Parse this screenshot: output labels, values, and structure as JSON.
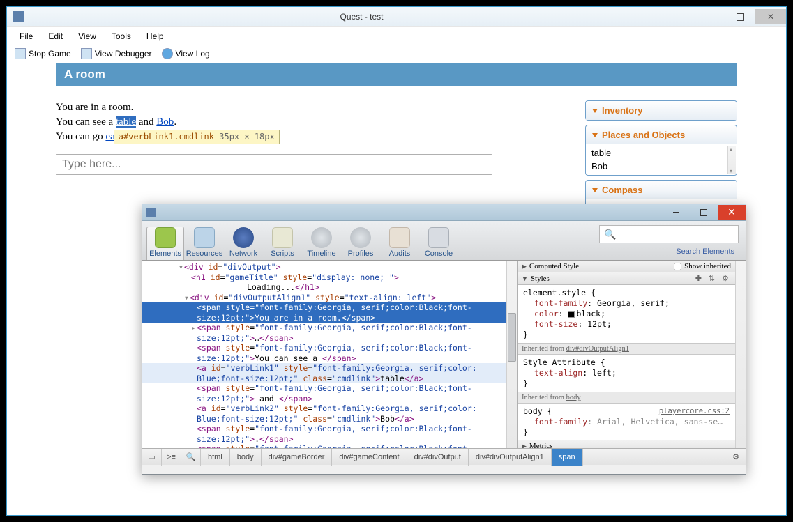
{
  "quest": {
    "title": "Quest - test",
    "menu": [
      "File",
      "Edit",
      "View",
      "Tools",
      "Help"
    ],
    "menu_ul": [
      "F",
      "E",
      "V",
      "T",
      "H"
    ],
    "toolbar": [
      "Stop Game",
      "View Debugger",
      "View Log"
    ],
    "room_title": "A room",
    "text": {
      "l1": "You are in a room.",
      "l2a": "You can see a ",
      "l2_link1": "table",
      "l2b": " and ",
      "l2_link2": "Bob",
      "l2c": ".",
      "l3a": "You can go ",
      "l3_link": "ea"
    },
    "tooltip_id": "a#verbLink1.cmdlink",
    "tooltip_dim": " 35px × 18px",
    "input_placeholder": "Type here...",
    "panels": {
      "inventory": "Inventory",
      "places": "Places and Objects",
      "places_items": [
        "table",
        "Bob"
      ],
      "compass": "Compass"
    }
  },
  "devtools": {
    "tabs": [
      "Elements",
      "Resources",
      "Network",
      "Scripts",
      "Timeline",
      "Profiles",
      "Audits",
      "Console"
    ],
    "search_label": "Search Elements",
    "tree": {
      "l0": "<div id=\"divOutput\">",
      "l1_a": "<h1 id=\"gameTitle\" style=\"display: none; \">",
      "l1_t": "Loading...",
      "l1_b": "</h1>",
      "l2": "<div id=\"divOutputAlign1\" style=\"text-align: left\">",
      "l3": "<span style=\"font-family:Georgia, serif;color:Black;font-size:12pt;\">You are in a room.</span>",
      "l4": "<span style=\"font-family:Georgia, serif;color:Black;font-size:12pt;\">…</span>",
      "l5_a": "<span style=\"font-family:Georgia, serif;color:Black;font-size:12pt;\">",
      "l5_t": "You can see a ",
      "l5_b": "</span>",
      "l6_a": "<a id=\"verbLink1\" style=\"font-family:Georgia, serif;color:Blue;font-size:12pt;\" class=\"cmdlink\">",
      "l6_t": "table",
      "l6_b": "</a>",
      "l7_a": "<span style=\"font-family:Georgia, serif;color:Black;font-size:12pt;\">",
      "l7_t": " and ",
      "l7_b": "</span>",
      "l8_a": "<a id=\"verbLink2\" style=\"font-family:Georgia, serif;color:Blue;font-size:12pt;\" class=\"cmdlink\">",
      "l8_t": "Bob",
      "l8_b": "</a>",
      "l9_a": "<span style=\"font-family:Georgia, serif;color:Black;font-size:12pt;\">",
      "l9_t": ".",
      "l9_b": "</span>",
      "l10": "<span style=\"font-family:Georgia, serif;color:Black;font-"
    },
    "styles": {
      "computed": "Computed Style",
      "show_inherited": "Show inherited",
      "styles_hdr": "Styles",
      "elem_style": "element.style {",
      "p1": "font-family",
      "v1": "Georgia, serif",
      "p2": "color",
      "v2": "black",
      "p3": "font-size",
      "v3": "12pt",
      "close": "}",
      "inh1": "Inherited from ",
      "inh1_link": "div#divOutputAlign1",
      "sa": "Style Attribute {",
      "p4": "text-align",
      "v4": "left",
      "inh2": "Inherited from ",
      "inh2_link": "body",
      "body_rule": "body {",
      "cssfile": "playercore.css:2",
      "p5": "font-family",
      "v5": "Arial, Helvetica, sans-se…",
      "metrics": "Metrics"
    },
    "crumbs": [
      "html",
      "body",
      "div#gameBorder",
      "div#gameContent",
      "div#divOutput",
      "div#divOutputAlign1",
      "span"
    ]
  }
}
